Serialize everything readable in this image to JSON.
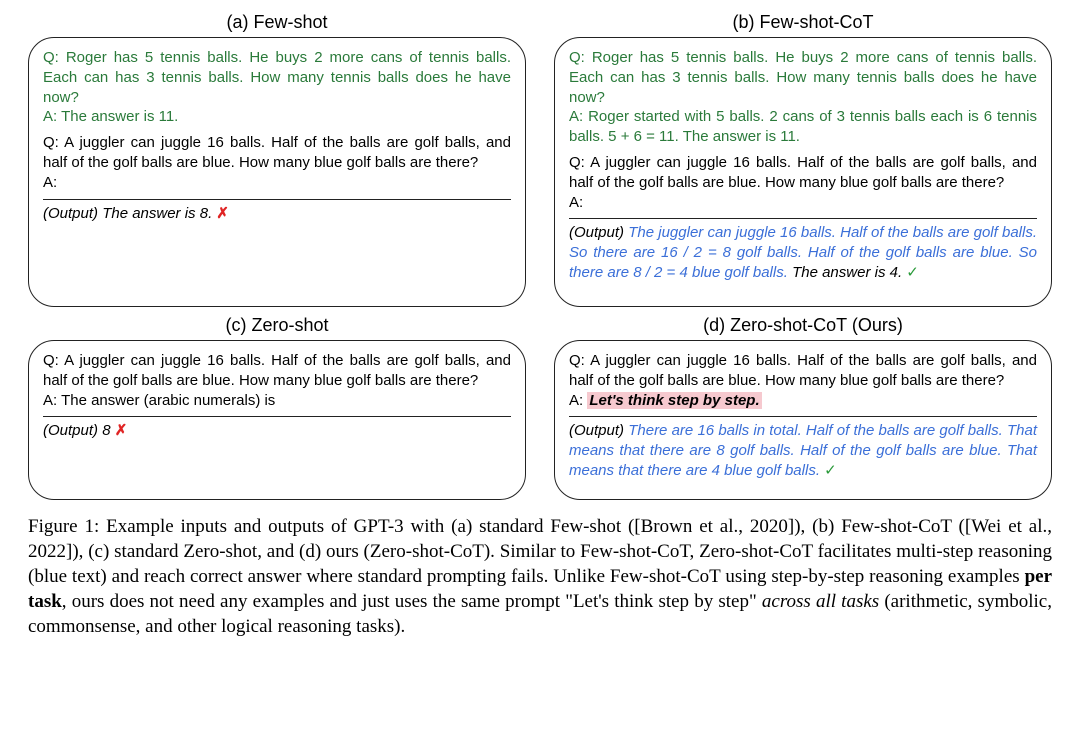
{
  "panels": {
    "a": {
      "title": "(a) Few-shot",
      "example": "Q: Roger has 5 tennis balls. He buys 2 more cans of tennis balls. Each can has 3 tennis balls. How many tennis balls does he have now?\nA: The answer is 11.",
      "query": "Q: A juggler can juggle 16 balls. Half of the balls are golf balls, and half of the golf balls are blue. How many blue golf balls are there?\nA:",
      "output_prefix": "(Output) ",
      "answer": "The answer is 8.",
      "mark": "✗"
    },
    "b": {
      "title": "(b) Few-shot-CoT",
      "example": "Q: Roger has 5 tennis balls. He buys 2 more cans of tennis balls. Each can has 3 tennis balls. How many tennis balls does he have now?\nA: Roger started with 5 balls. 2 cans of 3 tennis balls each is 6 tennis balls. 5 + 6 = 11. The answer is 11.",
      "query": "Q: A juggler can juggle 16 balls. Half of the balls are golf balls, and half of the golf balls are blue. How many blue golf balls are there?\nA:",
      "output_prefix": "(Output) ",
      "reasoning": "The juggler can juggle 16 balls. Half of the balls are golf balls. So there are 16 / 2 = 8 golf balls. Half of the golf balls are blue. So there are 8 / 2 = 4 blue golf balls.",
      "answer": " The answer is 4.",
      "mark": "✓"
    },
    "c": {
      "title": "(c) Zero-shot",
      "query": "Q: A juggler can juggle 16 balls. Half of the balls are golf balls, and half of the golf balls are blue. How many blue golf balls are there?\nA: The answer (arabic numerals) is",
      "output_prefix": "(Output) ",
      "answer": "8",
      "mark": "✗"
    },
    "d": {
      "title": "(d) Zero-shot-CoT (Ours)",
      "query_pre": "Q: A juggler can juggle 16 balls. Half of the balls are golf balls, and half of the golf balls are blue. How many blue golf balls are there?\nA: ",
      "highlight": "Let's think step by step.",
      "output_prefix": "(Output) ",
      "reasoning": "There are 16 balls in total. Half of the balls are golf balls. That means that there are 8 golf balls. Half of the golf balls are blue. That means that there are 4 blue golf balls.",
      "mark": "✓"
    }
  },
  "caption": {
    "prefix": "Figure 1: Example inputs and outputs of GPT-3 with (a) standard Few-shot ([Brown et al., 2020]), (b) Few-shot-CoT ([Wei et al., 2022]), (c) standard Zero-shot, and (d) ours (Zero-shot-CoT). Similar to Few-shot-CoT, Zero-shot-CoT facilitates multi-step reasoning (blue text) and reach correct answer where standard prompting fails. Unlike Few-shot-CoT using step-by-step reasoning examples ",
    "bold1": "per task",
    "middle": ", ours does not need any examples and just uses the same prompt \"Let's think step by step\" ",
    "italic1": "across all tasks",
    "suffix": " (arithmetic, symbolic, commonsense, and other logical reasoning tasks)."
  }
}
